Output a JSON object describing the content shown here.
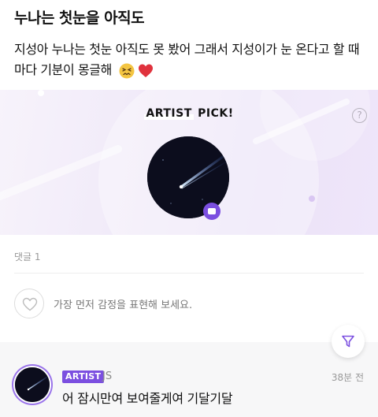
{
  "post": {
    "title": "누나는 첫눈을 아직도",
    "body": "지성아 누나는 첫눈 아직도 못 봤어 그래서 지성이가 눈 온다고 할 때마다 기분이 몽글해",
    "emojis": [
      "confounded-face-emoji",
      "red-heart-emoji"
    ]
  },
  "artist_pick": {
    "label_highlight": "ARTIST",
    "label_rest": " PICK!",
    "help_symbol": "?"
  },
  "comments": {
    "count_label": "댓글 1",
    "react_prompt": "가장 먼저 감정을 표현해 보세요.",
    "items": [
      {
        "badge": "ARTIST",
        "author": "JS",
        "time": "38분 전",
        "text": "어 잠시만여 보여줄게여 기달기달"
      }
    ]
  },
  "colors": {
    "accent": "#7b4fe0",
    "heart": "#e0323d"
  }
}
